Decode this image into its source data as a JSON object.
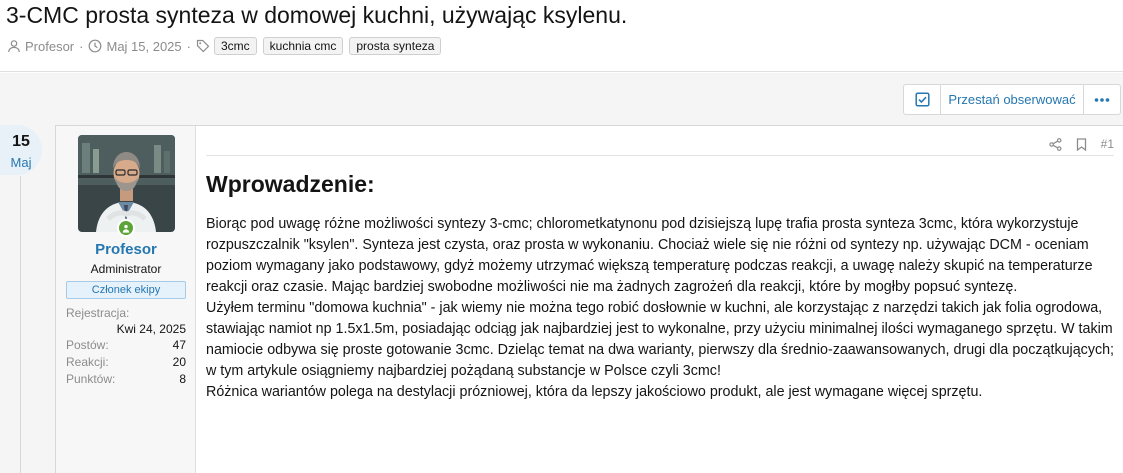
{
  "thread": {
    "title": "3-CMC prosta synteza w domowej kuchni, używając ksylenu.",
    "author": "Profesor",
    "date": "Maj 15, 2025",
    "tags": [
      "3cmc",
      "kuchnia cmc",
      "prosta synteza"
    ]
  },
  "actions": {
    "unfollow_label": "Przestań obserwować"
  },
  "post_date": {
    "day": "15",
    "month": "Maj"
  },
  "user": {
    "name": "Profesor",
    "role": "Administrator",
    "badge": "Członek ekipy",
    "stats": {
      "registration_label": "Rejestracja:",
      "registration_value": "Kwi 24, 2025",
      "posts_label": "Postów:",
      "posts_value": "47",
      "reactions_label": "Reakcji:",
      "reactions_value": "20",
      "points_label": "Punktów:",
      "points_value": "8"
    }
  },
  "post": {
    "number": "#1",
    "heading": "Wprowadzenie:",
    "paragraphs": [
      "Biorąc pod uwagę różne możliwości syntezy 3-cmc; chlorometkatynonu pod dzisiejszą lupę trafia prosta synteza 3cmc, która wykorzystuje rozpuszczalnik \"ksylen\". Synteza jest czysta, oraz prosta w wykonaniu. Chociaż wiele się nie różni od syntezy np. używając DCM - oceniam poziom wymagany jako podstawowy, gdyż możemy utrzymać większą temperaturę podczas reakcji, a uwagę należy skupić na temperaturze reakcji oraz czasie. Mając bardziej swobodne możliwości nie ma żadnych zagrożeń dla reakcji, które by mogłby popsuć syntezę.",
      "Użyłem terminu \"domowa kuchnia\" - jak wiemy nie można tego robić dosłownie w kuchni, ale korzystając z narzędzi takich jak folia ogrodowa, stawiając namiot np 1.5x1.5m, posiadając odciąg jak najbardziej jest to wykonalne, przy użyciu minimalnej ilości wymaganego sprzętu. W takim namiocie odbywa się proste gotowanie 3cmc. Dzieląc temat na dwa warianty, pierwszy dla średnio-zaawansowanych, drugi dla początkujących; w tym artykule osiągniemy najbardziej pożądaną substancje w Polsce czyli 3cmc!",
      "Różnica wariantów polega na destylacji prózniowej, która da lepszy jakościowo produkt, ale jest wymagane więcej sprzętu."
    ]
  },
  "icons": {
    "author": "user-icon",
    "date": "clock-icon",
    "tags": "tag-icon",
    "check": "check-square-icon",
    "more": "more-dots-icon",
    "share": "share-icon",
    "bookmark": "bookmark-icon",
    "online": "online-status-icon"
  },
  "colors": {
    "link": "#2577b1",
    "muted": "#8c8c8c",
    "online": "#5ca338",
    "badge_bg": "#e5f1fb"
  }
}
